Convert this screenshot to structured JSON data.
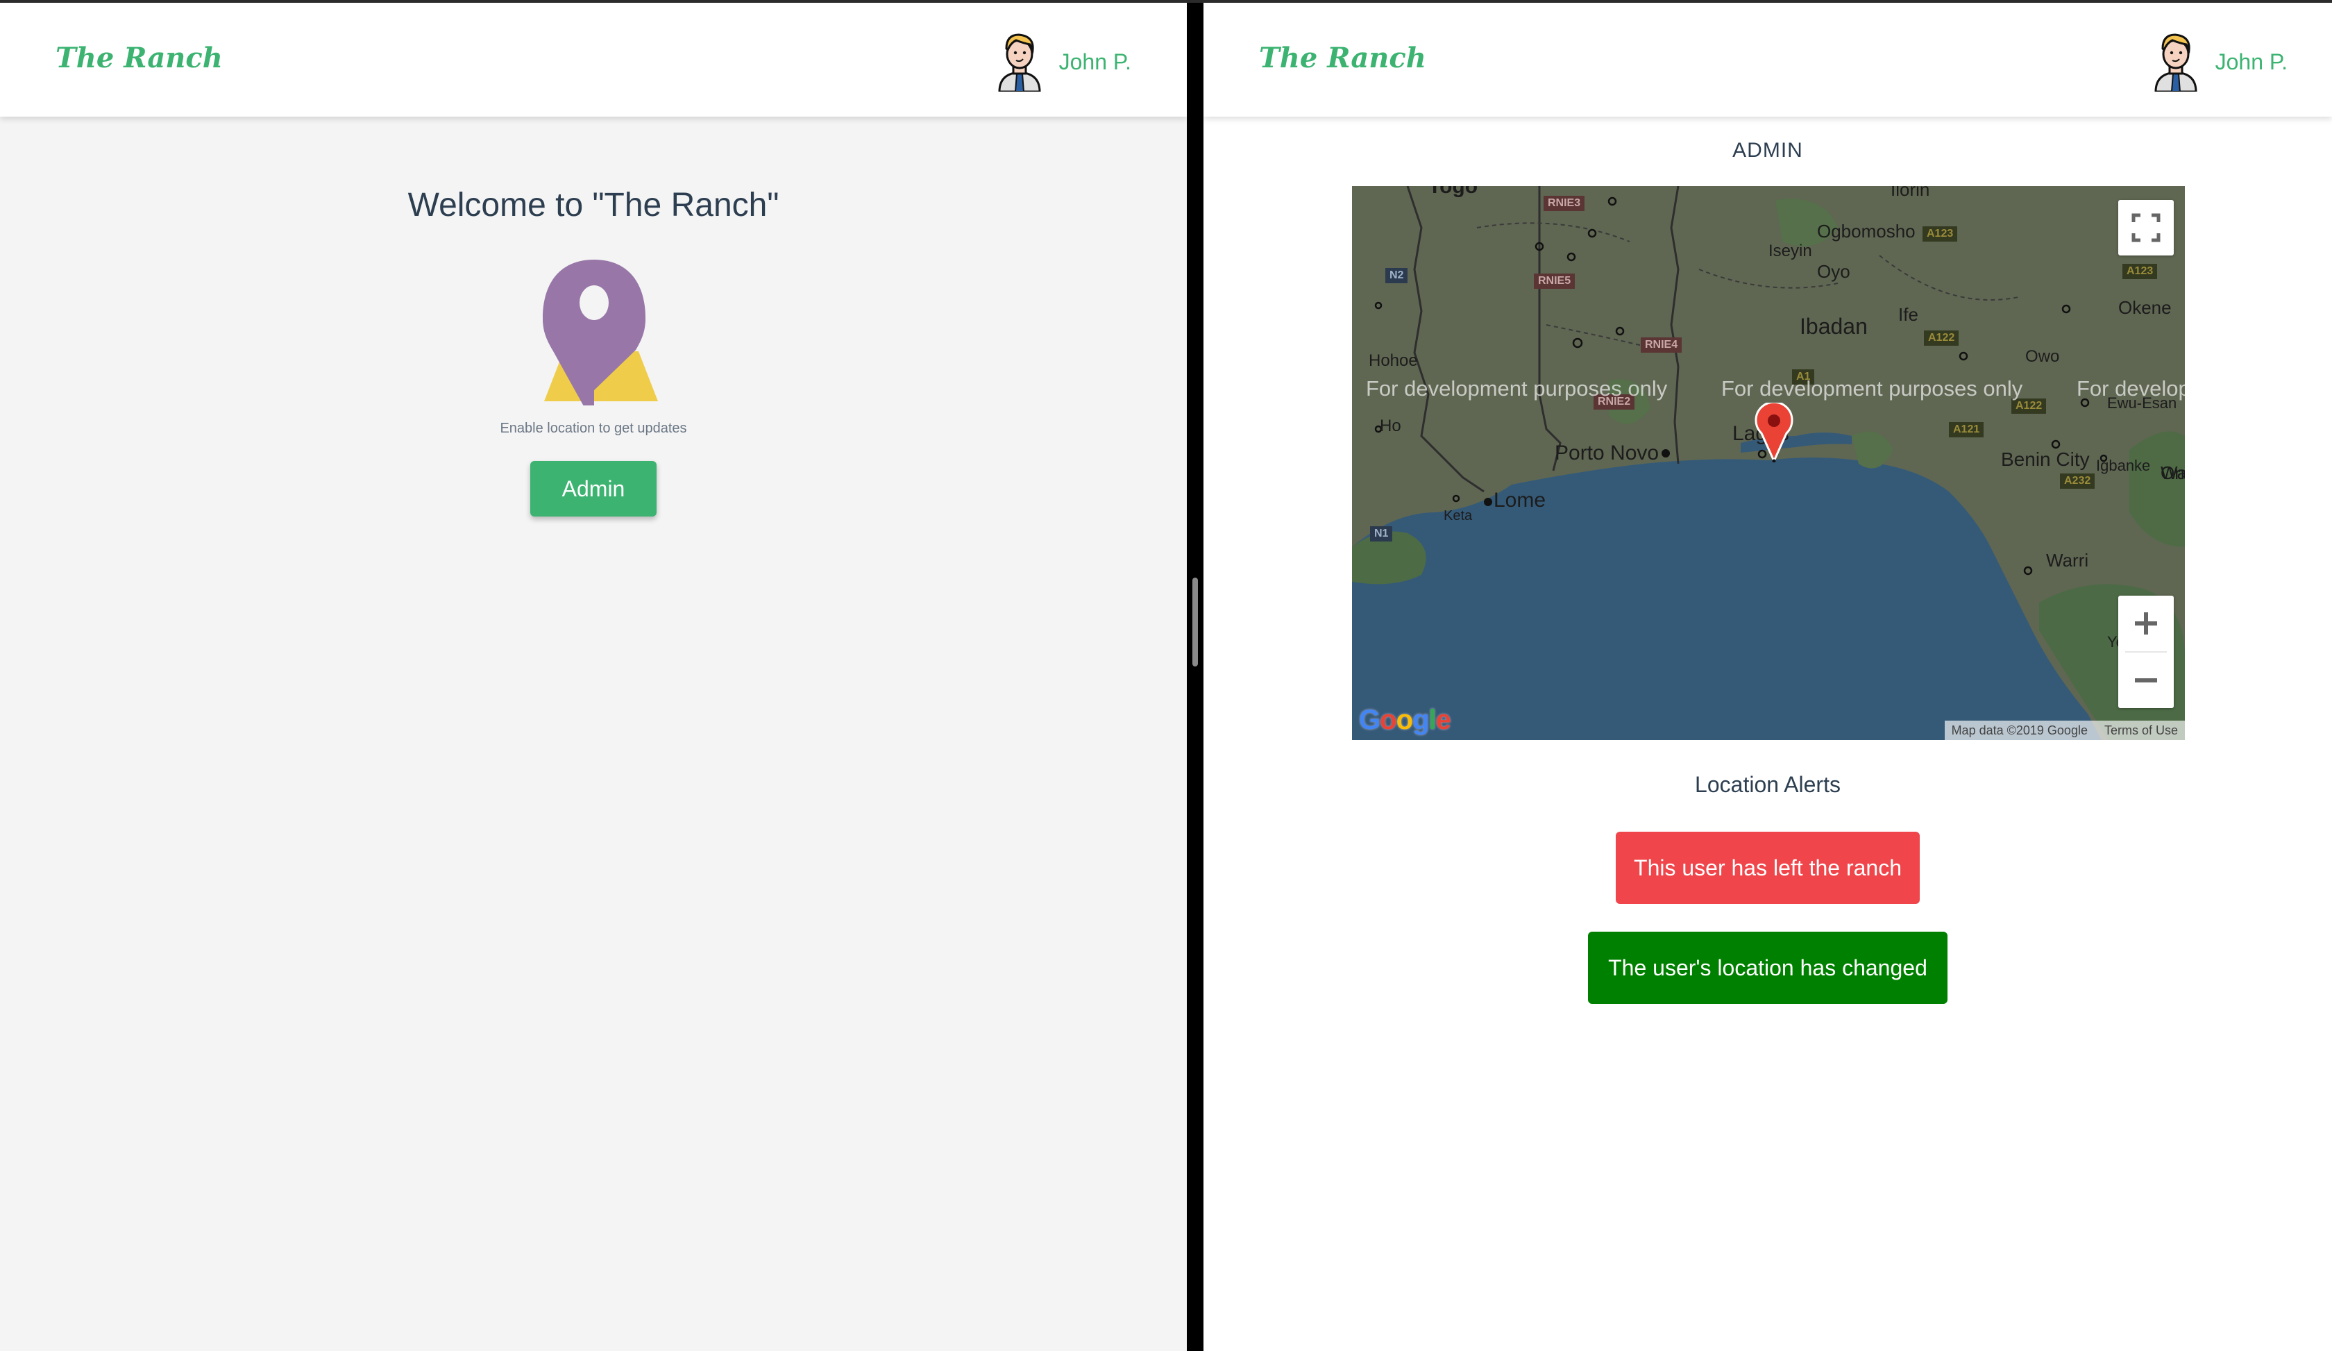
{
  "app": {
    "brand": "The Ranch",
    "user_name": "John P.",
    "accent_color": "#3cb371"
  },
  "left_pane": {
    "welcome_title": "Welcome to \"The Ranch\"",
    "illustration": "location-pin-on-map-icon",
    "hint": "Enable location to get updates",
    "admin_button": "Admin"
  },
  "right_pane": {
    "page_title": "ADMIN",
    "map": {
      "provider": "Google",
      "watermark": "For development purposes only",
      "attribution": "Map data ©2019 Google",
      "terms": "Terms of Use",
      "marker_location": "Lagos",
      "controls": {
        "fullscreen": "fullscreen-icon",
        "zoom_in": "+",
        "zoom_out": "−"
      },
      "places": [
        {
          "name": "Togo"
        },
        {
          "name": "Ilorin"
        },
        {
          "name": "Ogbomosho"
        },
        {
          "name": "Iseyin"
        },
        {
          "name": "Oyo"
        },
        {
          "name": "Ibadan"
        },
        {
          "name": "Ife"
        },
        {
          "name": "Okene"
        },
        {
          "name": "Owo"
        },
        {
          "name": "Ewu-Esan"
        },
        {
          "name": "Hohoe"
        },
        {
          "name": "Ho"
        },
        {
          "name": "Porto Novo"
        },
        {
          "name": "Lagos"
        },
        {
          "name": "Lome"
        },
        {
          "name": "Keta"
        },
        {
          "name": "Benin City"
        },
        {
          "name": "Igbanke"
        },
        {
          "name": "Warri"
        },
        {
          "name": "Oni"
        },
        {
          "name": "Ye"
        }
      ],
      "road_shields": [
        "RNIE3",
        "RNIE5",
        "RNIE4",
        "RNIE2",
        "N2",
        "N1",
        "A123",
        "A123",
        "A122",
        "A122",
        "A121",
        "A1",
        "A232"
      ]
    },
    "alerts_title": "Location Alerts",
    "alerts": [
      {
        "text": "This user has left the ranch",
        "color": "#f0454a"
      },
      {
        "text": "The user's location has changed",
        "color": "#008000"
      }
    ]
  }
}
